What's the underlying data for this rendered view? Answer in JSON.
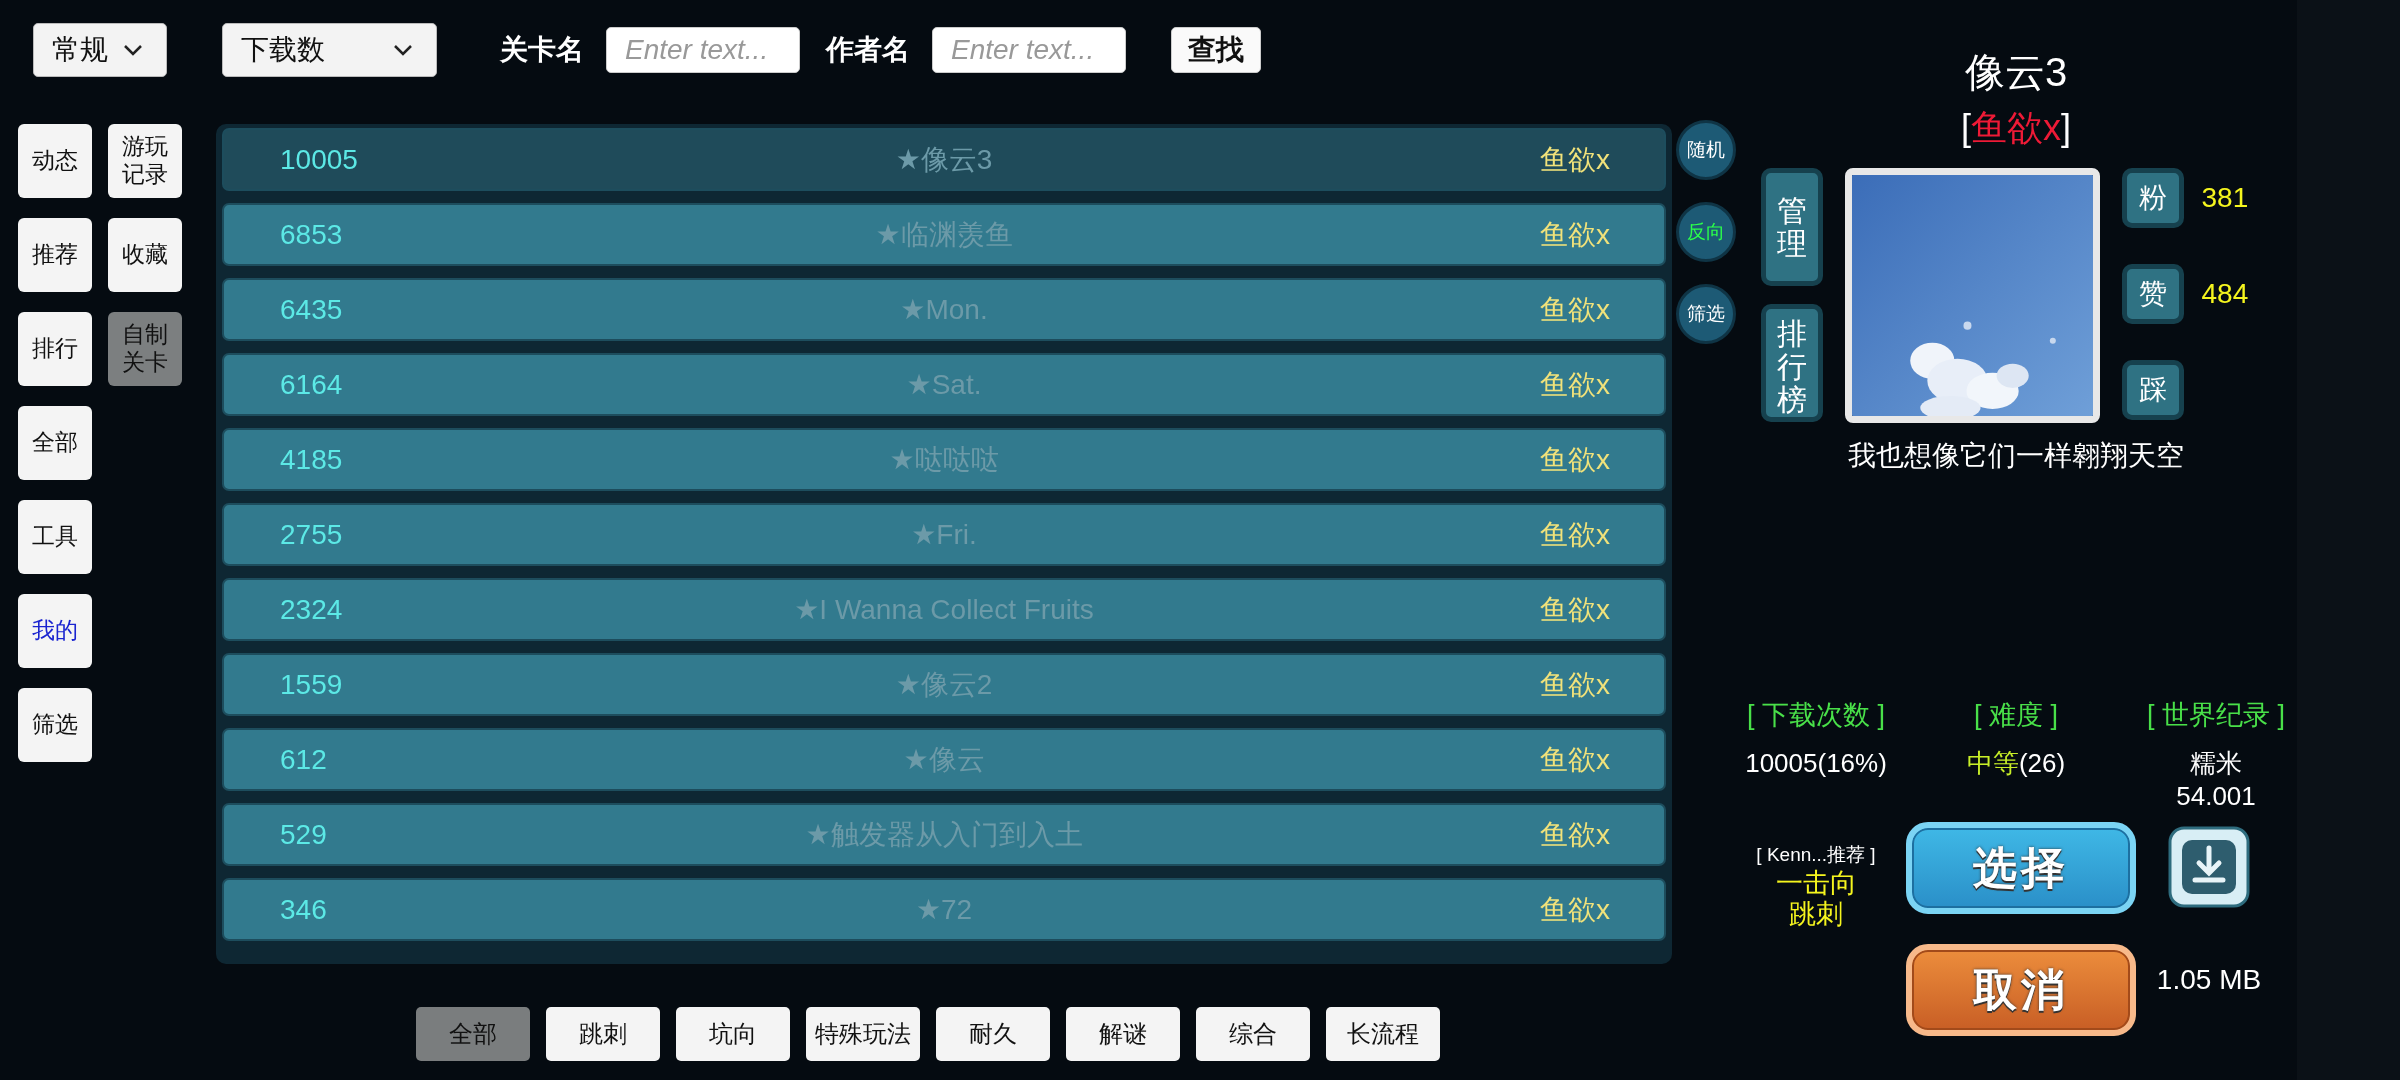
{
  "filters": {
    "mode": "常规",
    "sort": "下载数"
  },
  "search": {
    "level_label": "关卡名",
    "level_placeholder": "Enter text...",
    "author_label": "作者名",
    "author_placeholder": "Enter text...",
    "button": "查找"
  },
  "sidebar": {
    "left": [
      {
        "label": "动态",
        "selected": false,
        "highlighted": false
      },
      {
        "label": "推荐",
        "selected": false,
        "highlighted": false
      },
      {
        "label": "排行",
        "selected": false,
        "highlighted": false
      },
      {
        "label": "全部",
        "selected": false,
        "highlighted": false
      },
      {
        "label": "工具",
        "selected": false,
        "highlighted": false
      },
      {
        "label": "我的",
        "selected": false,
        "highlighted": true
      },
      {
        "label": "筛选",
        "selected": false,
        "highlighted": false
      }
    ],
    "right": [
      {
        "label": "游玩记录",
        "selected": false,
        "highlighted": false
      },
      {
        "label": "收藏",
        "selected": false,
        "highlighted": false
      },
      {
        "label": "自制关卡",
        "selected": true,
        "highlighted": false
      }
    ]
  },
  "levels": [
    {
      "downloads": "10005",
      "title": "★像云3",
      "author": "鱼欲x",
      "selected": true
    },
    {
      "downloads": "6853",
      "title": "★临渊羡鱼",
      "author": "鱼欲x",
      "selected": false
    },
    {
      "downloads": "6435",
      "title": "★Mon.",
      "author": "鱼欲x",
      "selected": false
    },
    {
      "downloads": "6164",
      "title": "★Sat.",
      "author": "鱼欲x",
      "selected": false
    },
    {
      "downloads": "4185",
      "title": "★哒哒哒",
      "author": "鱼欲x",
      "selected": false
    },
    {
      "downloads": "2755",
      "title": "★Fri.",
      "author": "鱼欲x",
      "selected": false
    },
    {
      "downloads": "2324",
      "title": "★I Wanna Collect Fruits",
      "author": "鱼欲x",
      "selected": false
    },
    {
      "downloads": "1559",
      "title": "★像云2",
      "author": "鱼欲x",
      "selected": false
    },
    {
      "downloads": "612",
      "title": "★像云",
      "author": "鱼欲x",
      "selected": false
    },
    {
      "downloads": "529",
      "title": "★触发器从入门到入土",
      "author": "鱼欲x",
      "selected": false
    },
    {
      "downloads": "346",
      "title": "★72",
      "author": "鱼欲x",
      "selected": false
    }
  ],
  "side_buttons": [
    {
      "label": "随机",
      "on": false
    },
    {
      "label": "反向",
      "on": true
    },
    {
      "label": "筛选",
      "on": false
    }
  ],
  "detail": {
    "title": "像云3",
    "author_open": "[",
    "author": "鱼欲x",
    "author_close": "]",
    "manage_buttons": [
      "管理",
      "排行榜"
    ],
    "picture": {
      "kind": "picture"
    },
    "reactions": [
      {
        "label": "粉",
        "count": "381"
      },
      {
        "label": "赞",
        "count": "484"
      },
      {
        "label": "踩"
      }
    ],
    "description": "我也想像它们一样翱翔天空",
    "downloads_heading": "[ 下载次数 ]",
    "downloads_value": "10005(16%)",
    "difficulty_heading": "[ 难度 ]",
    "difficulty_level": "中等",
    "difficulty_count": "(26)",
    "record_heading": "[ 世界纪录 ]",
    "record_holder": "糯米",
    "record_time": "54.001",
    "recommend_heading": "[ Kenn...推荐 ]",
    "recommend_tags": [
      "一击向",
      "跳刺"
    ],
    "select_button": "选择",
    "cancel_button": "取消",
    "file_size": "1.05 MB"
  },
  "categories": [
    {
      "label": "全部",
      "selected": true
    },
    {
      "label": "跳刺",
      "selected": false
    },
    {
      "label": "坑向",
      "selected": false
    },
    {
      "label": "特殊玩法",
      "selected": false
    },
    {
      "label": "耐久",
      "selected": false
    },
    {
      "label": "解谜",
      "selected": false
    },
    {
      "label": "综合",
      "selected": false
    },
    {
      "label": "长流程",
      "selected": false
    }
  ]
}
